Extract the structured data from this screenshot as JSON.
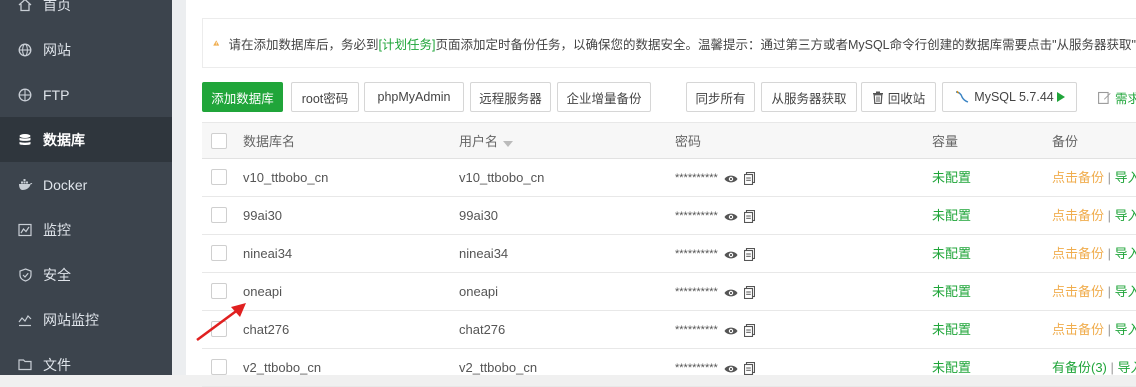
{
  "sidebar": {
    "items": [
      {
        "label": "首页",
        "icon": "home-icon"
      },
      {
        "label": "网站",
        "icon": "globe-icon"
      },
      {
        "label": "FTP",
        "icon": "ftp-icon"
      },
      {
        "label": "数据库",
        "icon": "database-icon",
        "active": true
      },
      {
        "label": "Docker",
        "icon": "docker-icon"
      },
      {
        "label": "监控",
        "icon": "monitor-icon"
      },
      {
        "label": "安全",
        "icon": "shield-icon"
      },
      {
        "label": "网站监控",
        "icon": "site-monitor-icon"
      },
      {
        "label": "文件",
        "icon": "folder-icon"
      }
    ]
  },
  "notice": {
    "prefix": "请在添加数据库后，务必到",
    "link": "[计划任务]",
    "suffix": "页面添加定时备份任务，以确保您的数据安全。温馨提示：通过第三方或者MySQL命令行创建的数据库需要点击\"从服务器获取\"才能"
  },
  "toolbar": {
    "add_db": "添加数据库",
    "root_pwd": "root密码",
    "phpmyadmin": "phpMyAdmin",
    "remote": "远程服务器",
    "enterprise_backup": "企业增量备份",
    "sync_all": "同步所有",
    "fetch_from_server": "从服务器获取",
    "recycle": "回收站",
    "mysql_version": "MySQL 5.7.44",
    "needs": "需求"
  },
  "table": {
    "headers": {
      "name": "数据库名",
      "user": "用户名",
      "password": "密码",
      "capacity": "容量",
      "backup": "备份"
    },
    "rows": [
      {
        "name": "v10_ttbobo_cn",
        "user": "v10_ttbobo_cn",
        "password": "**********",
        "capacity": "未配置",
        "backup": "点击备份",
        "import": "导入"
      },
      {
        "name": "99ai30",
        "user": "99ai30",
        "password": "**********",
        "capacity": "未配置",
        "backup": "点击备份",
        "import": "导入"
      },
      {
        "name": "nineai34",
        "user": "nineai34",
        "password": "**********",
        "capacity": "未配置",
        "backup": "点击备份",
        "import": "导入"
      },
      {
        "name": "oneapi",
        "user": "oneapi",
        "password": "**********",
        "capacity": "未配置",
        "backup": "点击备份",
        "import": "导入"
      },
      {
        "name": "chat276",
        "user": "chat276",
        "password": "**********",
        "capacity": "未配置",
        "backup": "点击备份",
        "import": "导入"
      },
      {
        "name": "v2_ttbobo_cn",
        "user": "v2_ttbobo_cn",
        "password": "**********",
        "capacity": "未配置",
        "backup": "有备份(3)",
        "import": "导入"
      }
    ],
    "separator": "|"
  },
  "colors": {
    "accent": "#20a53a",
    "warning": "#f0ad4e",
    "sidebar_bg": "#3c444d",
    "arrow": "#e02020"
  }
}
